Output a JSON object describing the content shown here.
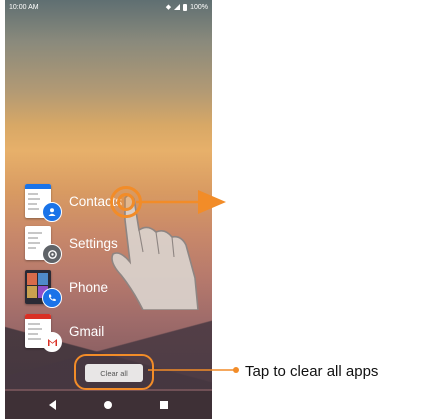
{
  "status_bar": {
    "time": "10:00 AM",
    "battery": "100%"
  },
  "apps": [
    {
      "label": "Contacts",
      "icon": "contacts-icon",
      "color": "#1a73e8"
    },
    {
      "label": "Settings",
      "icon": "settings-icon",
      "color": "#5f6368"
    },
    {
      "label": "Phone",
      "icon": "phone-icon",
      "color": "#1a73e8"
    },
    {
      "label": "Gmail",
      "icon": "gmail-icon",
      "color": "#ffffff"
    }
  ],
  "clear_all_label": "Clear all",
  "callout": {
    "text": "Tap to clear all apps"
  },
  "colors": {
    "accent": "#f28c28"
  }
}
